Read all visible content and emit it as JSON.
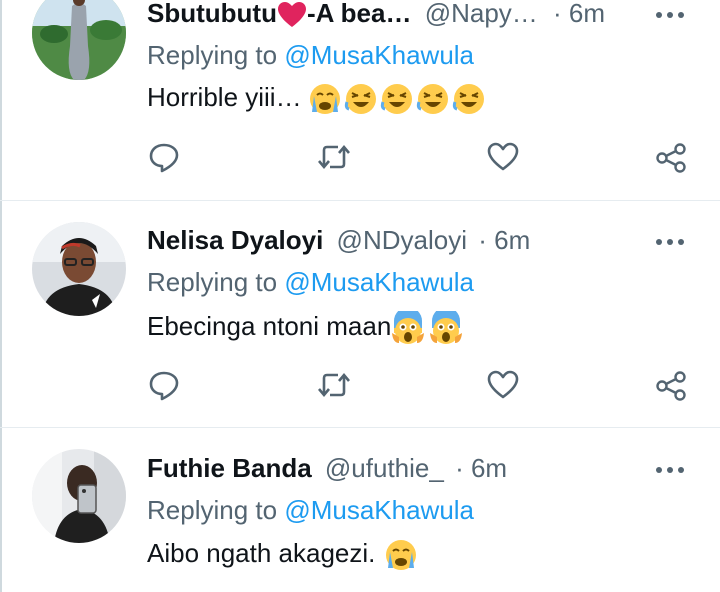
{
  "tweets": [
    {
      "name": "Sbutubutu",
      "name_tail": "-A bea…",
      "handle": "@Napy…",
      "separator": "·",
      "time": "6m",
      "replying_prefix": "Replying to ",
      "replying_to": "@MusaKhawula",
      "text": "Horrible yiii…",
      "emojis": [
        "crying-face",
        "rofl",
        "rofl",
        "rofl",
        "rofl"
      ]
    },
    {
      "name": "Nelisa Dyaloyi",
      "handle": "@NDyaloyi",
      "separator": "·",
      "time": "6m",
      "replying_prefix": "Replying to ",
      "replying_to": "@MusaKhawula",
      "text": "Ebecinga ntoni maan",
      "emojis": [
        "screaming-face",
        "screaming-face"
      ]
    },
    {
      "name": "Futhie Banda",
      "handle": "@ufuthie_",
      "separator": "·",
      "time": "6m",
      "replying_prefix": "Replying to ",
      "replying_to": "@MusaKhawula",
      "text": "Aibo ngath akagezi.",
      "emojis": [
        "crying-face"
      ]
    }
  ],
  "actions": [
    "reply-icon",
    "retweet-icon",
    "like-icon",
    "share-icon"
  ],
  "colors": {
    "accent": "#1d9bf0",
    "secondary_text": "#536471",
    "heart": "#e0245e",
    "divider": "#e6ecf0"
  }
}
